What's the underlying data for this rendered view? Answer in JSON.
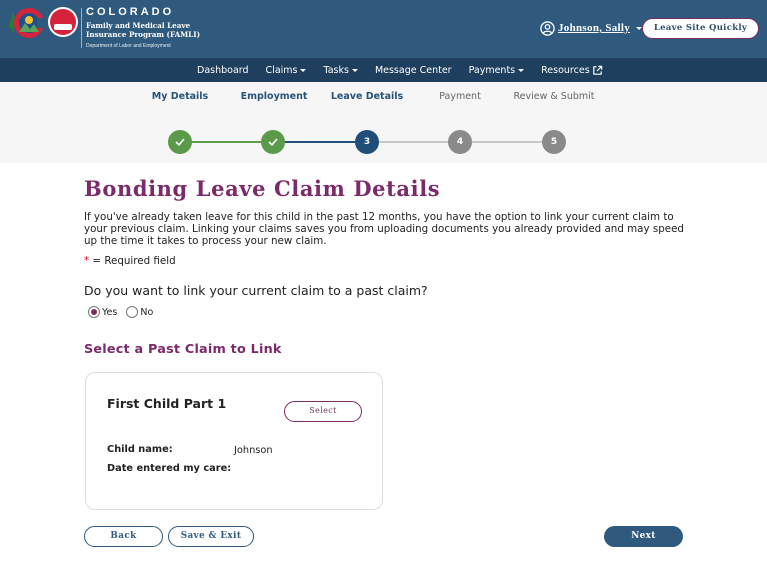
{
  "header": {
    "brand_state": "COLORADO",
    "brand_program_line1": "Family and Medical Leave",
    "brand_program_line2": "Insurance Program (FAMLI)",
    "brand_department": "Department of Labor and Employment",
    "agency_badge": "CDLE",
    "user_name": "Johnson, Sally",
    "leave_site_label": "Leave Site Quickly"
  },
  "nav": {
    "items": [
      {
        "label": "Dashboard",
        "has_dropdown": false,
        "external": false
      },
      {
        "label": "Claims",
        "has_dropdown": true,
        "external": false
      },
      {
        "label": "Tasks",
        "has_dropdown": true,
        "external": false
      },
      {
        "label": "Message Center",
        "has_dropdown": false,
        "external": false
      },
      {
        "label": "Payments",
        "has_dropdown": true,
        "external": false
      },
      {
        "label": "Resources",
        "has_dropdown": false,
        "external": true
      }
    ]
  },
  "stepper": {
    "current_step": 3,
    "steps": [
      {
        "label": "My Details",
        "number": "1",
        "status": "complete"
      },
      {
        "label": "Employment",
        "number": "2",
        "status": "complete"
      },
      {
        "label": "Leave Details",
        "number": "3",
        "status": "current"
      },
      {
        "label": "Payment",
        "number": "4",
        "status": "upcoming"
      },
      {
        "label": "Review & Submit",
        "number": "5",
        "status": "upcoming"
      }
    ]
  },
  "main": {
    "title": "Bonding Leave Claim Details",
    "intro": "If you've already taken leave for this child in the past 12 months, you have the option to link your current claim to your previous claim. Linking your claims saves you from uploading documents you already provided and may speed up the time it takes to process your new claim.",
    "required_star": "*",
    "required_note": " = Required field",
    "question": "Do you want to link your current claim to a past claim?",
    "options": [
      {
        "label": "Yes",
        "checked": true
      },
      {
        "label": "No",
        "checked": false
      }
    ],
    "section_heading": "Select a Past Claim to Link",
    "claim_card": {
      "title": "First Child Part 1",
      "select_label": "Select",
      "fields": [
        {
          "label": "Child name:",
          "value": "Johnson"
        },
        {
          "label": "Date entered my care:",
          "value": ""
        }
      ]
    }
  },
  "footer_buttons": {
    "back": "Back",
    "save_exit": "Save & Exit",
    "next": "Next"
  },
  "colors": {
    "header_bg": "#2f5a7e",
    "nav_bg": "#1f3f5e",
    "accent_purple": "#7b2a6a",
    "step_complete": "#5a9a48",
    "step_current": "#1f4e79",
    "step_upcoming": "#8a8a8a"
  }
}
